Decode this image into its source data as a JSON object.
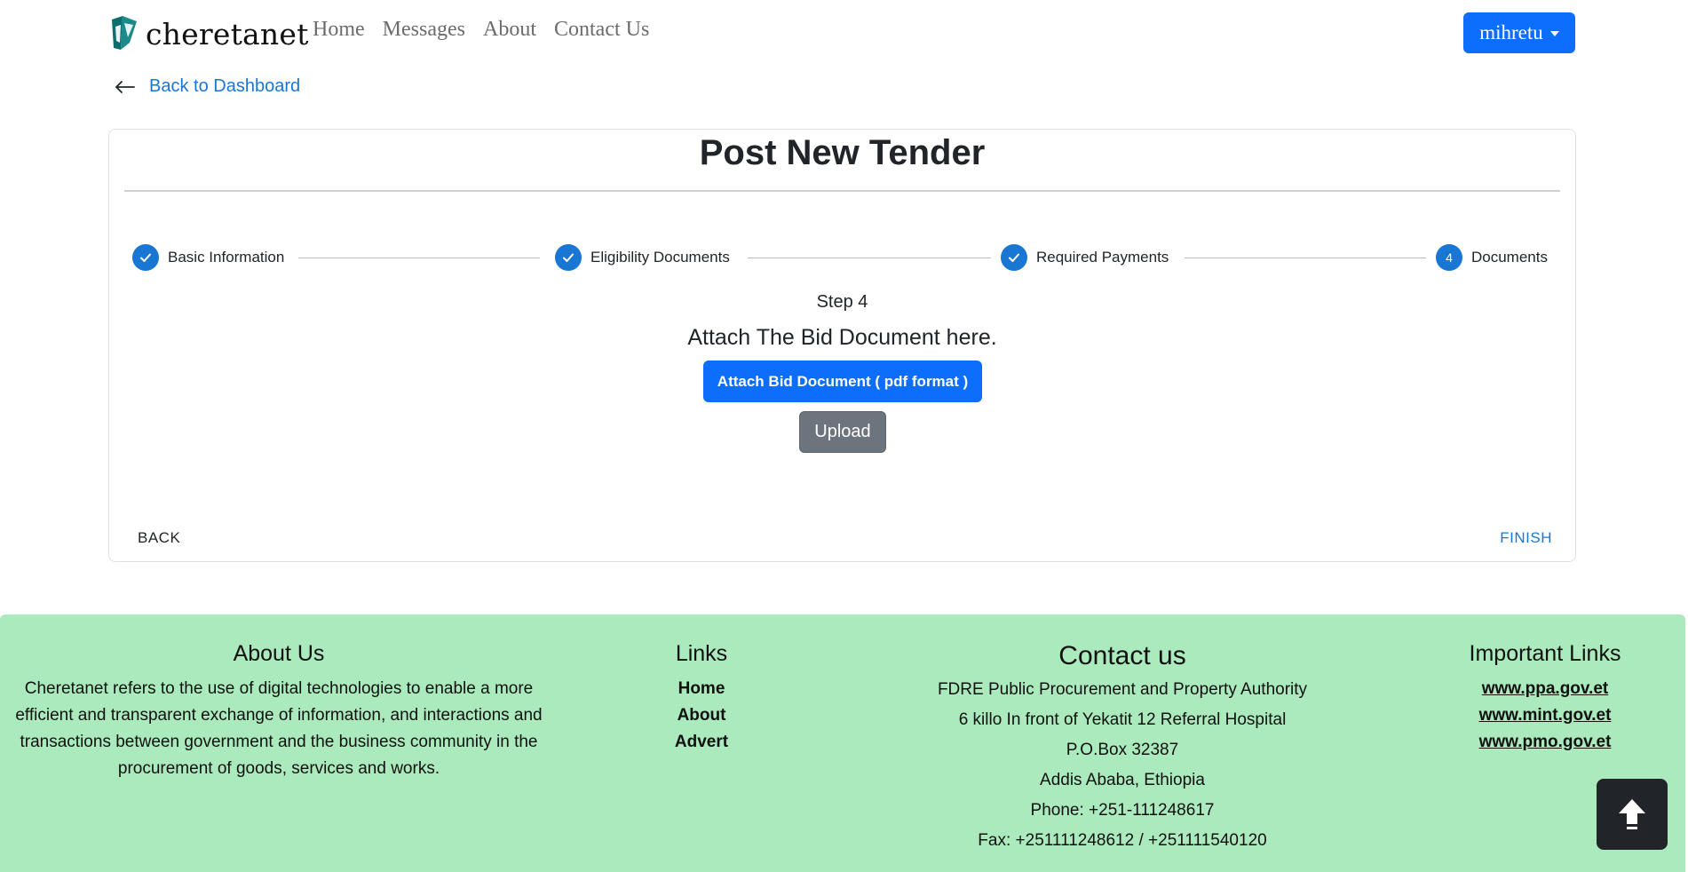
{
  "navbar": {
    "brand": "cheretanet",
    "links": [
      "Home",
      "Messages",
      "About",
      "Contact Us"
    ],
    "user": "mihretu"
  },
  "back_link": "Back to Dashboard",
  "card": {
    "title": "Post New Tender",
    "steps": [
      {
        "label": "Basic Information",
        "state": "completed"
      },
      {
        "label": "Eligibility Documents",
        "state": "completed"
      },
      {
        "label": "Required Payments",
        "state": "completed"
      },
      {
        "label": "Documents",
        "state": "active",
        "number": "4"
      }
    ],
    "step_number": "Step 4",
    "heading": "Attach The Bid Document here.",
    "attach_button": "Attach Bid Document ( pdf format )",
    "upload_button": "Upload",
    "back_button": "BACK",
    "finish_button": "FINISH"
  },
  "footer": {
    "about_title": "About Us",
    "about_text": "Cheretanet refers to the use of digital technologies to enable a more efficient and transparent exchange of information, and interactions and transactions between government and the business community in the procurement of goods, services and works.",
    "links_title": "Links",
    "links": [
      "Home",
      "About",
      "Advert"
    ],
    "contact_title": "Contact us",
    "contact_lines": [
      "FDRE Public Procurement and Property Authority",
      "6 killo In front of Yekatit 12 Referral Hospital",
      "P.O.Box 32387",
      "Addis Ababa, Ethiopia",
      "Phone: +251-111248617",
      "Fax: +251111248612 / +251111540120"
    ],
    "important_title": "Important Links",
    "important_links": [
      "www.ppa.gov.et",
      "www.mint.gov.et",
      "www.pmo.gov.et"
    ]
  },
  "colors": {
    "primary": "#0d6efd",
    "step": "#1976d2",
    "secondary": "#6c757d",
    "footer_bg": "#abeabd",
    "dark": "#212529"
  },
  "icons": [
    "cheretanet-logo-icon",
    "caret-down-icon",
    "arrow-left-icon",
    "check-icon",
    "arrow-up-icon"
  ]
}
